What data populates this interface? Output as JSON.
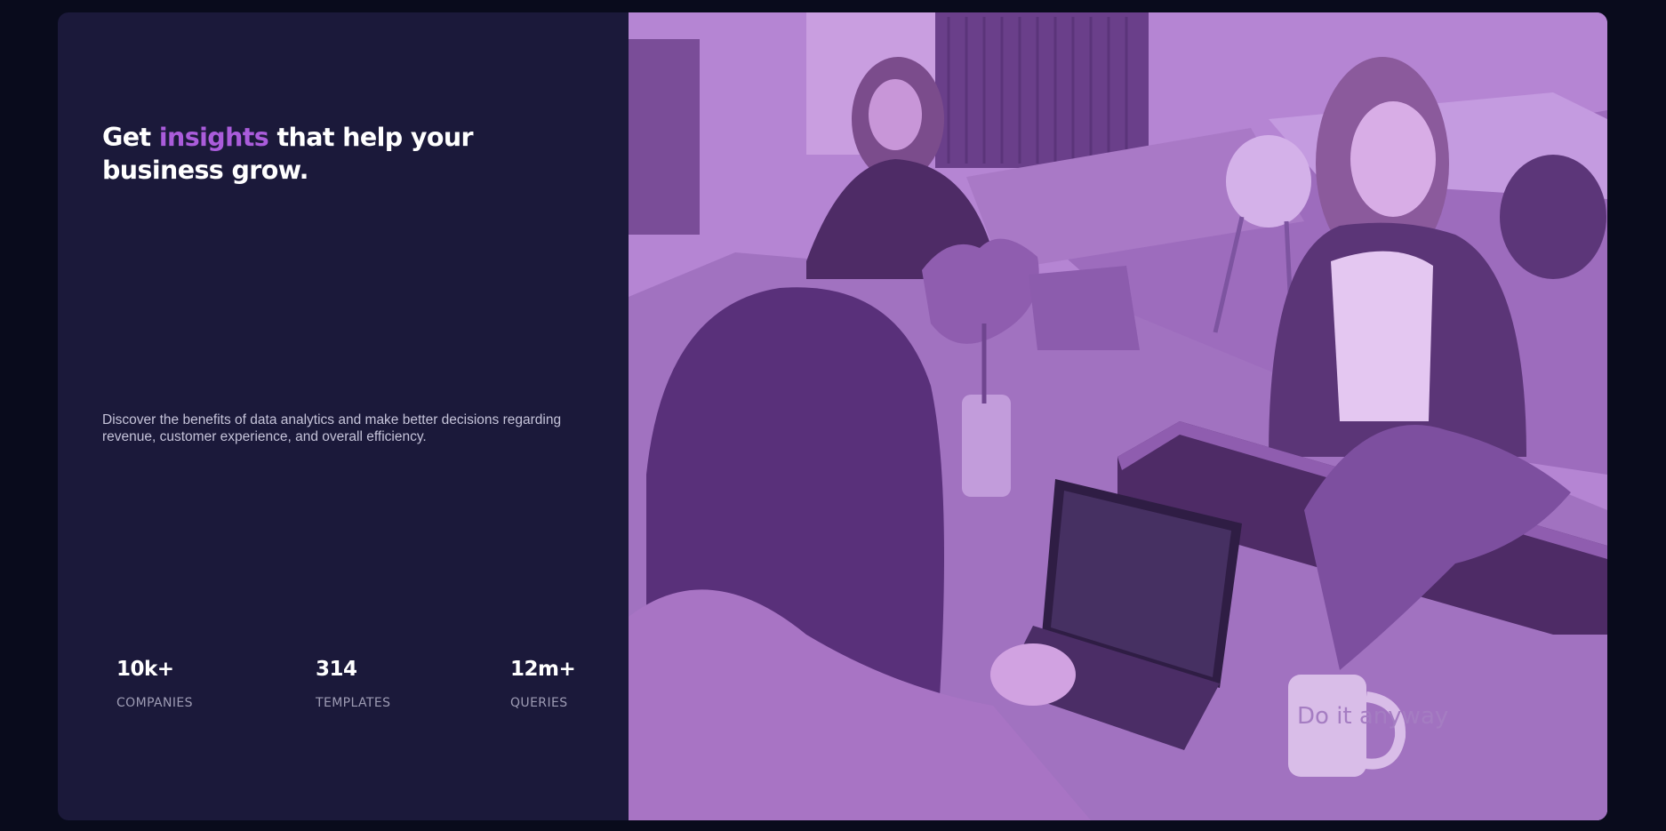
{
  "hero": {
    "headline": {
      "before": "Get ",
      "accent": "insights",
      "after": " that help your business grow."
    },
    "description": "Discover the benefits of data analytics and make better decisions regarding revenue, customer experience, and overall efficiency.",
    "stats": [
      {
        "value": "10k+",
        "label": "COMPANIES"
      },
      {
        "value": "314",
        "label": "TEMPLATES"
      },
      {
        "value": "12m+",
        "label": "QUERIES"
      }
    ]
  },
  "photo": {
    "subject": "team-working-at-office-table-photo",
    "mug_text": "Do it anyway"
  },
  "colors": {
    "page_background": "#090b1c",
    "card_background": "#1b193a",
    "accent": "#aa5cdb",
    "photo_tint": "#b585d3"
  }
}
